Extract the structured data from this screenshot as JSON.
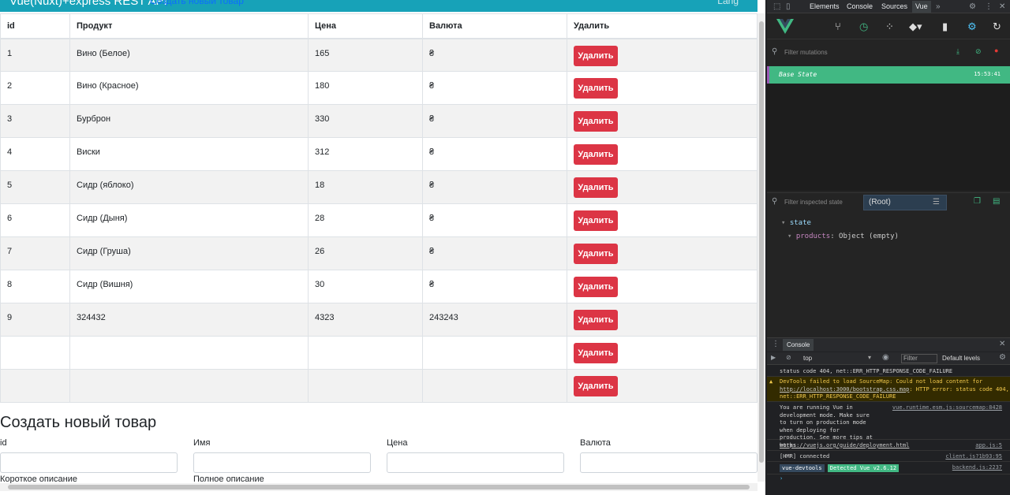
{
  "navbar": {
    "brand": "Vue(Nuxt)+express REST API",
    "link": "Создать новый товар",
    "right": "Lang"
  },
  "table": {
    "headers": [
      "id",
      "Продукт",
      "Цена",
      "Валюта",
      "Удалить"
    ],
    "rows": [
      {
        "id": "1",
        "product": "Вино (Белое)",
        "price": "165",
        "currency": "₴",
        "action": "Удалить"
      },
      {
        "id": "2",
        "product": "Вино (Красное)",
        "price": "180",
        "currency": "₴",
        "action": "Удалить"
      },
      {
        "id": "3",
        "product": "Бурброн",
        "price": "330",
        "currency": "₴",
        "action": "Удалить"
      },
      {
        "id": "4",
        "product": "Виски",
        "price": "312",
        "currency": "₴",
        "action": "Удалить"
      },
      {
        "id": "5",
        "product": "Сидр (яблоко)",
        "price": "18",
        "currency": "₴",
        "action": "Удалить"
      },
      {
        "id": "6",
        "product": "Сидр (Дыня)",
        "price": "28",
        "currency": "₴",
        "action": "Удалить"
      },
      {
        "id": "7",
        "product": "Сидр (Груша)",
        "price": "26",
        "currency": "₴",
        "action": "Удалить"
      },
      {
        "id": "8",
        "product": "Сидр (Вишня)",
        "price": "30",
        "currency": "₴",
        "action": "Удалить"
      },
      {
        "id": "9",
        "product": "324432",
        "price": "4323",
        "currency": "243243",
        "action": "Удалить"
      },
      {
        "id": "",
        "product": "",
        "price": "",
        "currency": "",
        "action": "Удалить"
      },
      {
        "id": "",
        "product": "",
        "price": "",
        "currency": "",
        "action": "Удалить"
      }
    ]
  },
  "create_form": {
    "title": "Создать новый товар",
    "labels": [
      "id",
      "Имя",
      "Цена",
      "Валюта"
    ],
    "labels2": [
      "Короткое описание",
      "Полное описание"
    ]
  },
  "devtools": {
    "tabs": [
      "Elements",
      "Console",
      "Sources",
      "Vue"
    ],
    "active_tab": "Vue",
    "filter_mutations_placeholder": "Filter mutations",
    "base_state_label": "Base State",
    "base_state_time": "15:53:41",
    "filter_state_placeholder": "Filter inspected state",
    "root_select": "(Root)",
    "state_key": "state",
    "products_key": "products",
    "products_value": "Object (empty)"
  },
  "console": {
    "tab": "Console",
    "context": "top",
    "filter_placeholder": "Filter",
    "levels": "Default levels",
    "messages": [
      {
        "text": "status code 404, net::ERR_HTTP_RESPONSE_CODE_FAILURE",
        "src": ""
      },
      {
        "text_pre": "DevTools failed to load SourceMap: Could not load content for ",
        "link": "http://localhost:3000/bootstrap.css.map",
        "text_post": ": HTTP error: status code 404, net::ERR_HTTP_RESPONSE_CODE_FAILURE",
        "src": ""
      },
      {
        "text": "You are running Vue in development mode. Make sure to turn on production mode when deploying for production. See more tips at ",
        "link": "https://vuejs.org/guide/deployment.html",
        "src": "vue.runtime.esm.js:sourcemap:8428"
      },
      {
        "text": "works",
        "src": "app.js:5"
      },
      {
        "text": "[HMR] connected",
        "src": "client.js?1b93:95"
      },
      {
        "badge1": "vue-devtools",
        "badge2": "Detected Vue v2.6.12",
        "src": "backend.js:2237"
      }
    ]
  },
  "colors": {
    "navbar": "#17a2b8",
    "delete_button": "#dc3545",
    "vue_green": "#41b883"
  }
}
